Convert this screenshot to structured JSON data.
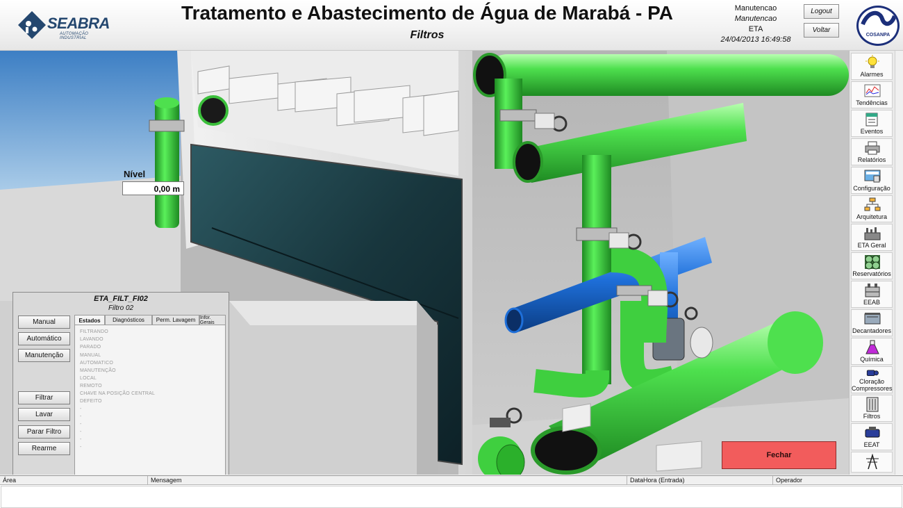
{
  "header": {
    "logo_text": "SEABRA",
    "logo_sub": "AUTOMAÇÃO INDUSTRIAL",
    "title": "Tratamento e Abastecimento de Água de Marabá - PA",
    "subtitle": "Filtros",
    "user_name": "Manutencao",
    "user_group": "Manutencao",
    "station": "ETA",
    "datetime": "24/04/2013 16:49:58",
    "logout_label": "Logout",
    "back_label": "Voltar",
    "partner_logo": "COSANPA"
  },
  "scene": {
    "level_label": "Nível",
    "level_value": "0,00 m",
    "close_label": "Fechar"
  },
  "panel": {
    "tag": "ETA_FILT_FI02",
    "name": "Filtro 02",
    "mode_buttons": [
      "Manual",
      "Automático",
      "Manutenção"
    ],
    "command_buttons": [
      "Filtrar",
      "Lavar",
      "Parar Filtro",
      "Rearme"
    ],
    "tabs": [
      "Estados",
      "Diagnósticos",
      "Perm. Lavagem",
      "Infor. Gerais"
    ],
    "active_tab": "Estados",
    "states": [
      "FILTRANDO",
      "LAVANDO",
      "PARADO",
      "MANUAL",
      "AUTOMATICO",
      "MANUTENÇÃO",
      "LOCAL",
      "REMOTO",
      "CHAVE NA POSIÇÃO CENTRAL",
      "DEFEITO",
      "-",
      "-",
      "-",
      "-",
      "-",
      "-"
    ]
  },
  "sidebar": {
    "items": [
      {
        "label": "Alarmes",
        "icon": "lightbulb-icon"
      },
      {
        "label": "Tendências",
        "icon": "trend-chart-icon"
      },
      {
        "label": "Eventos",
        "icon": "events-icon"
      },
      {
        "label": "Relatórios",
        "icon": "printer-icon"
      },
      {
        "label": "Configuração",
        "icon": "config-icon"
      },
      {
        "label": "Arquitetura",
        "icon": "network-icon"
      },
      {
        "label": "ETA Geral",
        "icon": "plant-icon"
      },
      {
        "label": "Reservatórios",
        "icon": "reservoir-icon"
      },
      {
        "label": "EEAB",
        "icon": "pump-station-icon"
      },
      {
        "label": "Decantadores",
        "icon": "decanter-icon"
      },
      {
        "label": "Química",
        "icon": "flask-icon"
      },
      {
        "label": "Cloração Compressores",
        "icon": "compressor-icon"
      },
      {
        "label": "Filtros",
        "icon": "filter-icon"
      },
      {
        "label": "EEAT",
        "icon": "pump-icon"
      },
      {
        "label": "",
        "icon": "tower-icon"
      }
    ]
  },
  "alarm_table": {
    "columns": [
      "Área",
      "Mensagem",
      "DataHora (Entrada)",
      "Operador"
    ]
  },
  "colors": {
    "pipe_green": "#4ee04e",
    "pipe_blue": "#1e6fd9",
    "close_button": "#f25c5c",
    "water": "#1d3f46"
  }
}
